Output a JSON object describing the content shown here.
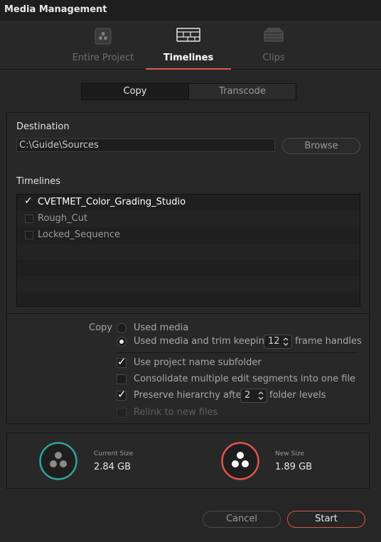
{
  "window": {
    "title": "Media Management"
  },
  "tabs": [
    {
      "label": "Entire Project",
      "icon": "project-icon",
      "active": false
    },
    {
      "label": "Timelines",
      "icon": "timelines-icon",
      "active": true
    },
    {
      "label": "Clips",
      "icon": "clips-icon",
      "active": false
    }
  ],
  "mode": {
    "options": [
      "Copy",
      "Transcode"
    ],
    "selected": "Copy"
  },
  "destination": {
    "label": "Destination",
    "path": "C:\\Guide\\Sources",
    "browse_label": "Browse"
  },
  "timelines": {
    "label": "Timelines",
    "items": [
      {
        "name": "CVETMET_Color_Grading_Studio",
        "checked": true
      },
      {
        "name": "Rough_Cut",
        "checked": false
      },
      {
        "name": "Locked_Sequence",
        "checked": false
      }
    ]
  },
  "copy_options": {
    "label": "Copy",
    "used_media": "Used media",
    "trim_before": "Used media and trim keeping",
    "trim_value": "12",
    "trim_after": "frame handles",
    "selected": "trim"
  },
  "checks": {
    "subfolder": {
      "label": "Use project name subfolder",
      "checked": true
    },
    "consolidate": {
      "label": "Consolidate multiple edit segments into one file",
      "checked": false
    },
    "preserve_before": "Preserve hierarchy after",
    "preserve_value": "2",
    "preserve_after": "folder levels",
    "preserve_checked": true,
    "relink": {
      "label": "Relink to new files",
      "checked": false,
      "disabled": true
    }
  },
  "sizes": {
    "current": {
      "caption": "Current Size",
      "value": "2.84 GB",
      "ring_color": "#2fa59c"
    },
    "new": {
      "caption": "New Size",
      "value": "1.89 GB",
      "ring_color": "#e0564c"
    }
  },
  "buttons": {
    "cancel": "Cancel",
    "start": "Start"
  },
  "colors": {
    "accent": "#e0564c",
    "teal": "#2fa59c"
  }
}
